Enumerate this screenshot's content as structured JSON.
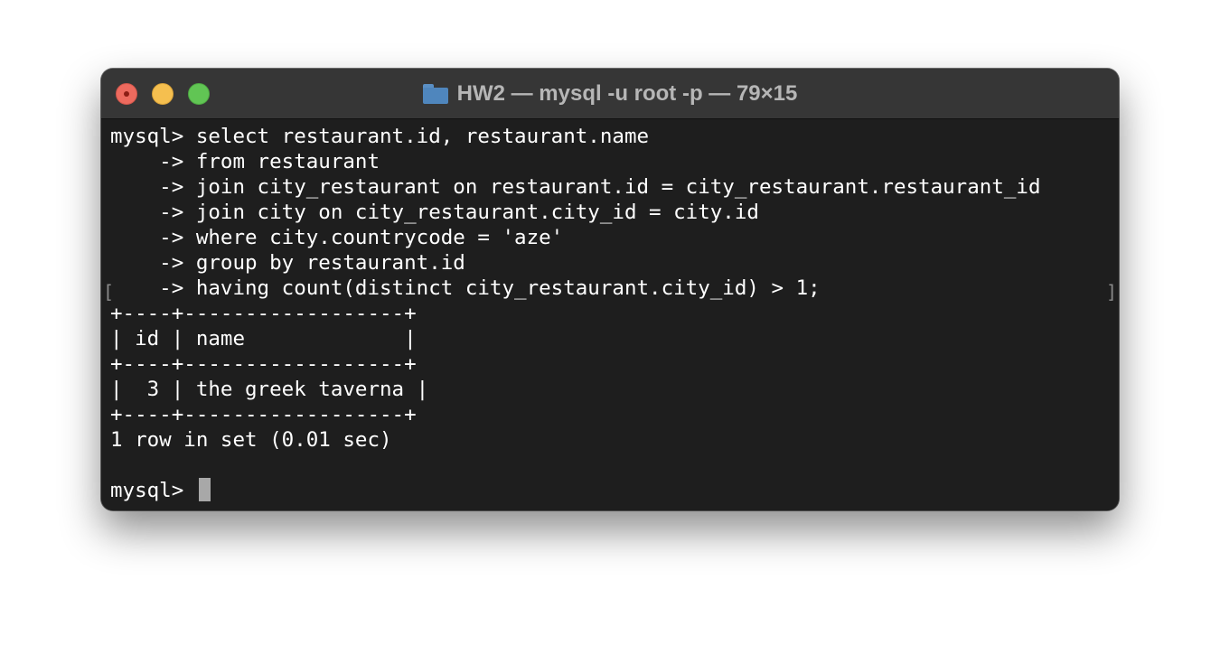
{
  "window": {
    "title": "HW2 — mysql -u root -p — 79×15",
    "title_icon": "folder-icon"
  },
  "terminal": {
    "lines": [
      "mysql> select restaurant.id, restaurant.name",
      "    -> from restaurant",
      "    -> join city_restaurant on restaurant.id = city_restaurant.restaurant_id",
      "    -> join city on city_restaurant.city_id = city.id",
      "    -> where city.countrycode = 'aze'",
      "    -> group by restaurant.id",
      "    -> having count(distinct city_restaurant.city_id) > 1;",
      "+----+------------------+",
      "| id | name             |",
      "+----+------------------+",
      "|  3 | the greek taverna |",
      "+----+------------------+",
      "1 row in set (0.01 sec)",
      "",
      "mysql> "
    ],
    "mark_left": "[",
    "mark_right": "]"
  },
  "colors": {
    "background": "#1e1e1e",
    "titlebar": "#363636",
    "text": "#ffffff",
    "close": "#ed6a5e",
    "minimize": "#f5bf4f",
    "zoom": "#61c554"
  }
}
